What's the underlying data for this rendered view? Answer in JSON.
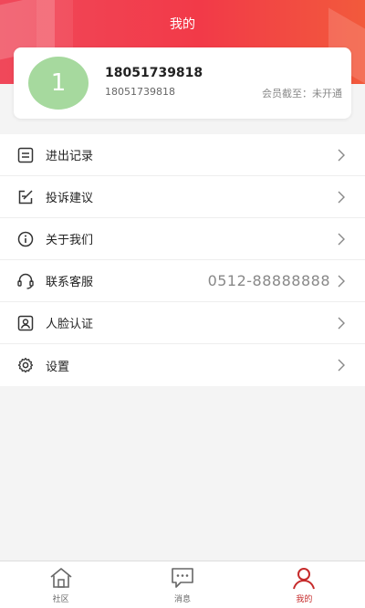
{
  "header": {
    "title": "我的"
  },
  "profile": {
    "avatar_text": "1",
    "name": "18051739818",
    "phone": "18051739818",
    "membership": "会员截至：未开通"
  },
  "menu": {
    "items": [
      {
        "label": "进出记录",
        "icon": "list-icon"
      },
      {
        "label": "投诉建议",
        "icon": "edit-icon"
      },
      {
        "label": "关于我们",
        "icon": "info-icon"
      },
      {
        "label": "联系客服",
        "icon": "headset-icon",
        "value": "0512-88888888"
      },
      {
        "label": "人脸认证",
        "icon": "face-id-icon"
      },
      {
        "label": "设置",
        "icon": "gear-icon"
      }
    ]
  },
  "tabbar": {
    "tabs": [
      {
        "label": "社区",
        "icon": "home-icon",
        "active": false
      },
      {
        "label": "消息",
        "icon": "message-icon",
        "active": false
      },
      {
        "label": "我的",
        "icon": "user-icon",
        "active": true
      }
    ]
  },
  "colors": {
    "accent": "#f23a48",
    "active_tab": "#c62b2b",
    "avatar_bg": "#a6d99e"
  }
}
